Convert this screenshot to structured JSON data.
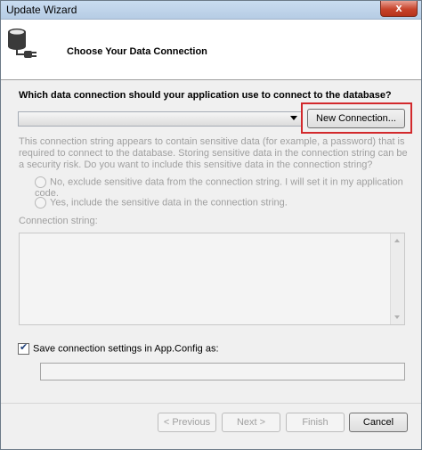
{
  "window": {
    "title": "Update Wizard",
    "close_glyph": "x"
  },
  "header": {
    "title": "Choose Your Data Connection",
    "icon": "database-plug-icon"
  },
  "question": "Which data connection should your application use to connect to the database?",
  "connection_combo": {
    "selected": ""
  },
  "new_connection_label": "New Connection...",
  "sensitive_info": "This connection string appears to contain sensitive data (for example, a password) that is required to connect to the database. Storing sensitive data in the connection string can be a security risk. Do you want to include this sensitive data in the connection string?",
  "radio_exclude": "No, exclude sensitive data from the connection string. I will set it in my application code.",
  "radio_include": "Yes, include the sensitive data in the connection string.",
  "connection_string_label": "Connection string:",
  "connection_string_value": "",
  "save_settings": {
    "label": "Save connection settings in App.Config as:",
    "checked": true,
    "value": ""
  },
  "buttons": {
    "previous": "< Previous",
    "next": "Next >",
    "finish": "Finish",
    "cancel": "Cancel"
  },
  "colors": {
    "highlight": "#d2292c",
    "disabled_text": "#a0a0a0"
  }
}
